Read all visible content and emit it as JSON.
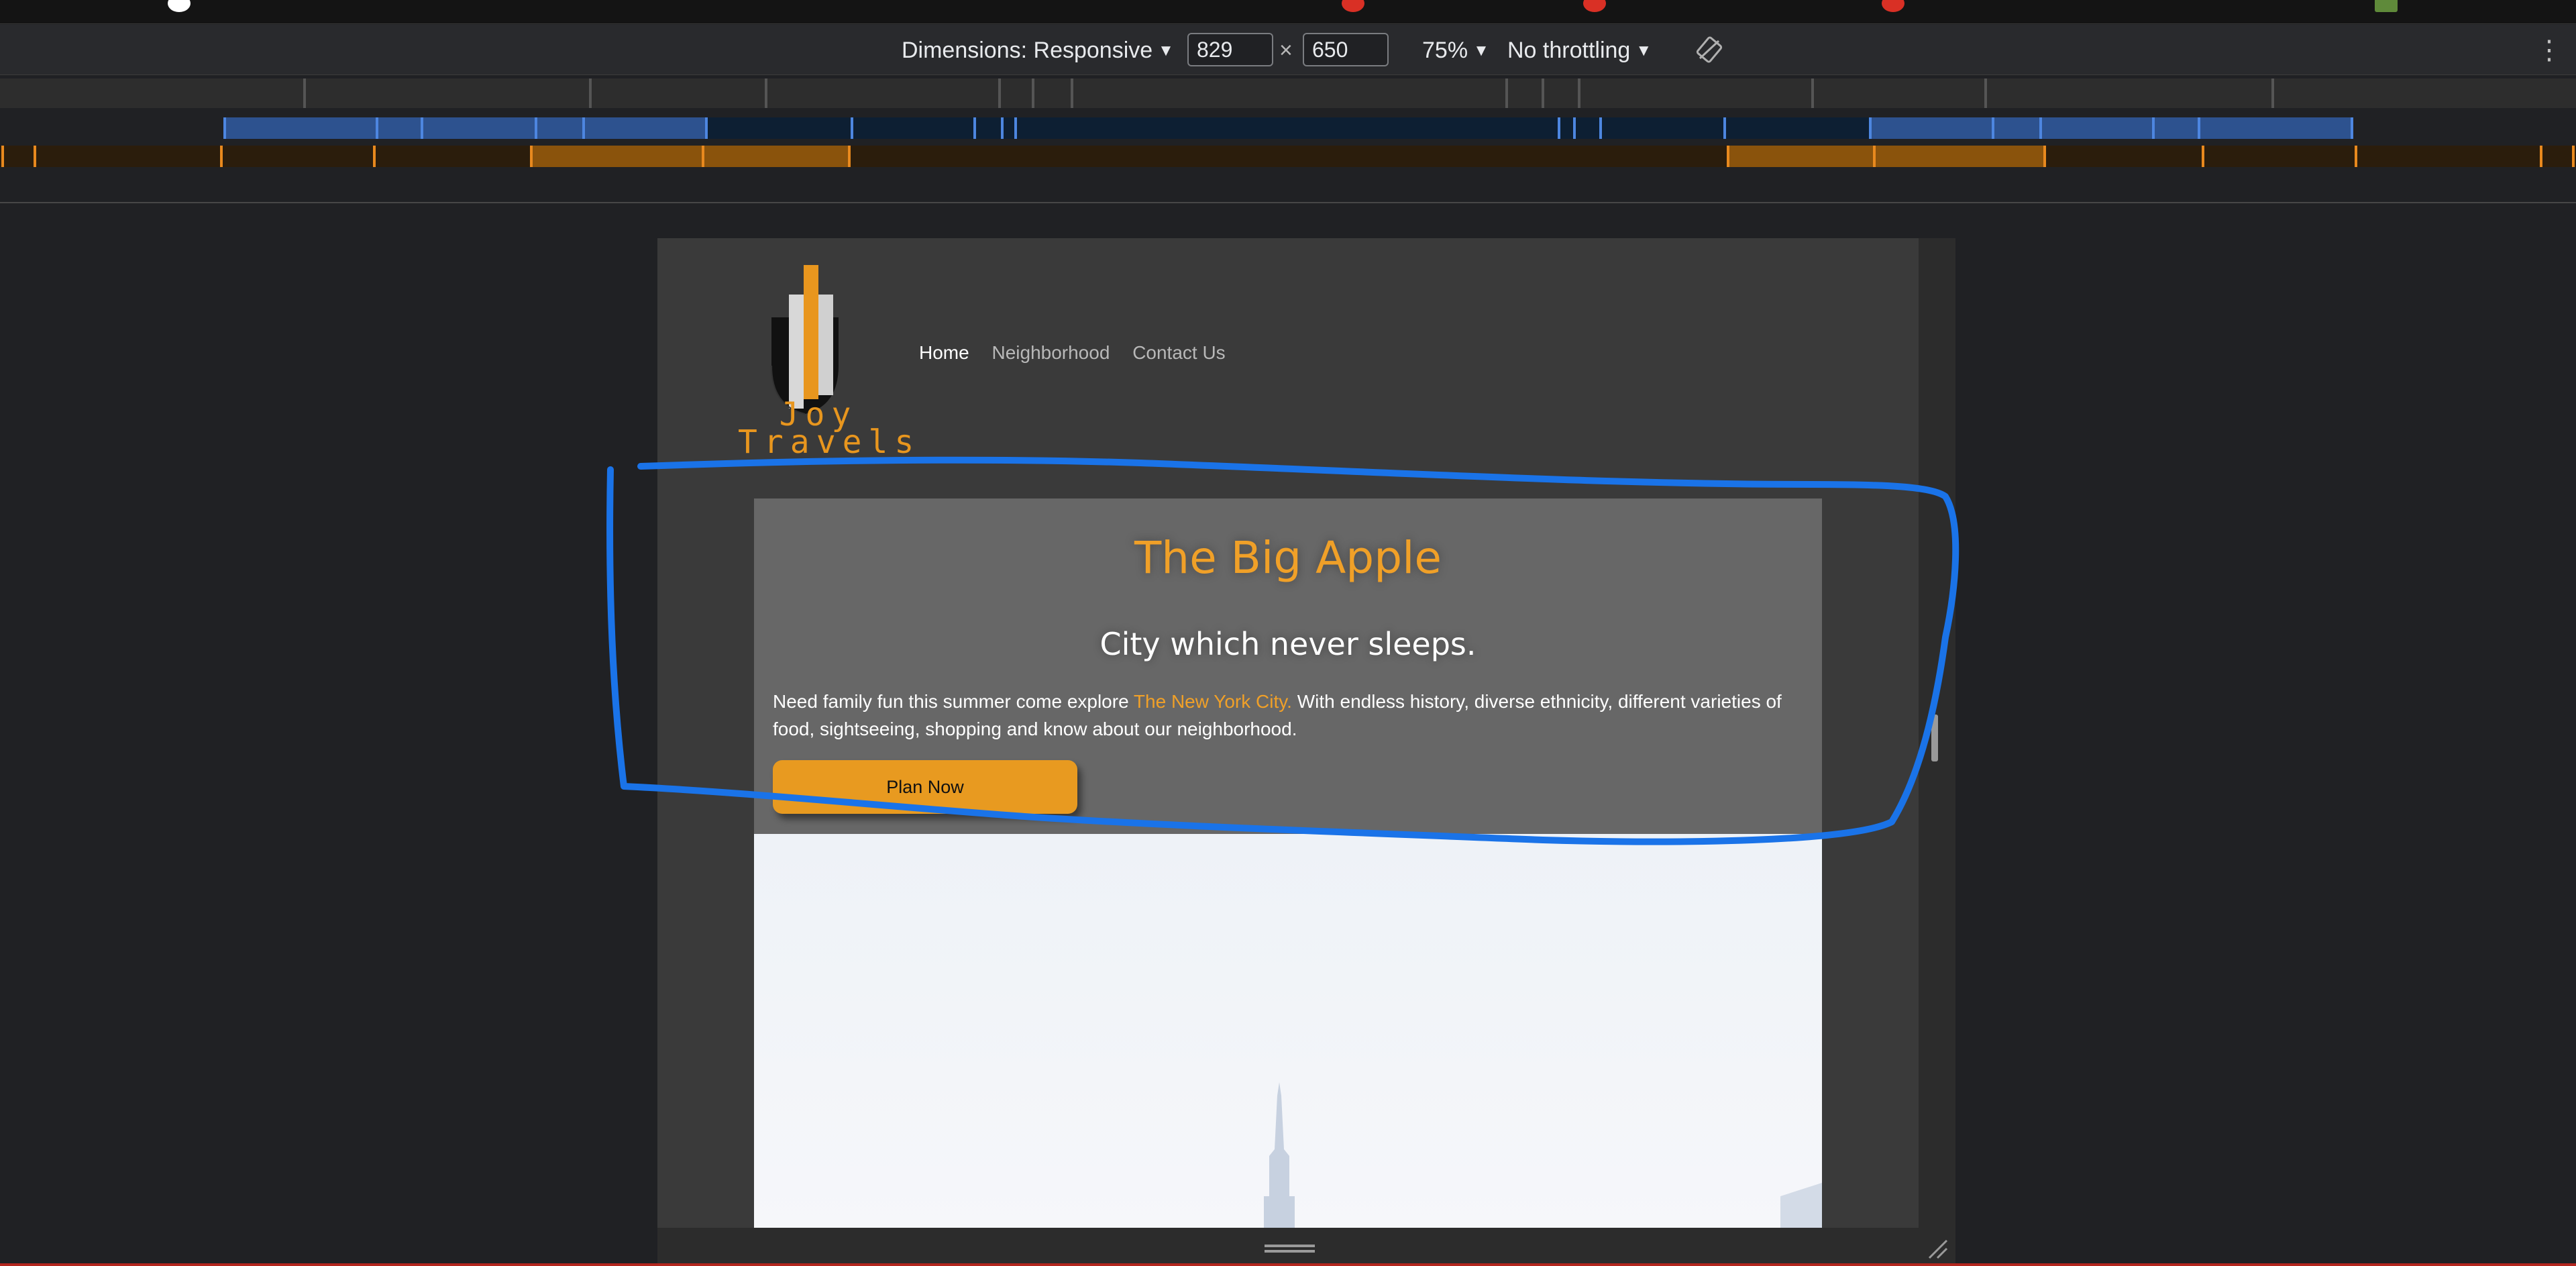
{
  "devtools": {
    "dimensions_label": "Dimensions: Responsive",
    "width_value": "829",
    "times_sign": "×",
    "height_value": "650",
    "zoom": "75%",
    "throttling": "No throttling",
    "caret": "▼",
    "more_menu": "⋮"
  },
  "site": {
    "logo_line1": "Joy",
    "logo_line2": "Travels",
    "nav": [
      {
        "label": "Home",
        "active": true
      },
      {
        "label": "Neighborhood",
        "active": false
      },
      {
        "label": "Contact Us",
        "active": false
      }
    ],
    "hero": {
      "title": "The Big Apple",
      "subtitle": "City which never sleeps.",
      "text_before": "Need family fun this summer come explore ",
      "text_highlight": "The New York City.",
      "text_after": " With endless history, diverse ethnicity, different varieties of food, sightseeing, shopping and know about our neighborhood.",
      "button": "Plan Now"
    }
  },
  "colors": {
    "accent": "#e89a20",
    "annotation": "#1a73e8",
    "toolbar": "#292a2d",
    "hero_bg": "#676767"
  },
  "icons": {
    "rotate": "rotate-icon",
    "more": "more-vert-icon",
    "resize_bottom": "resize-bottom-icon",
    "resize_corner": "resize-corner-icon"
  }
}
